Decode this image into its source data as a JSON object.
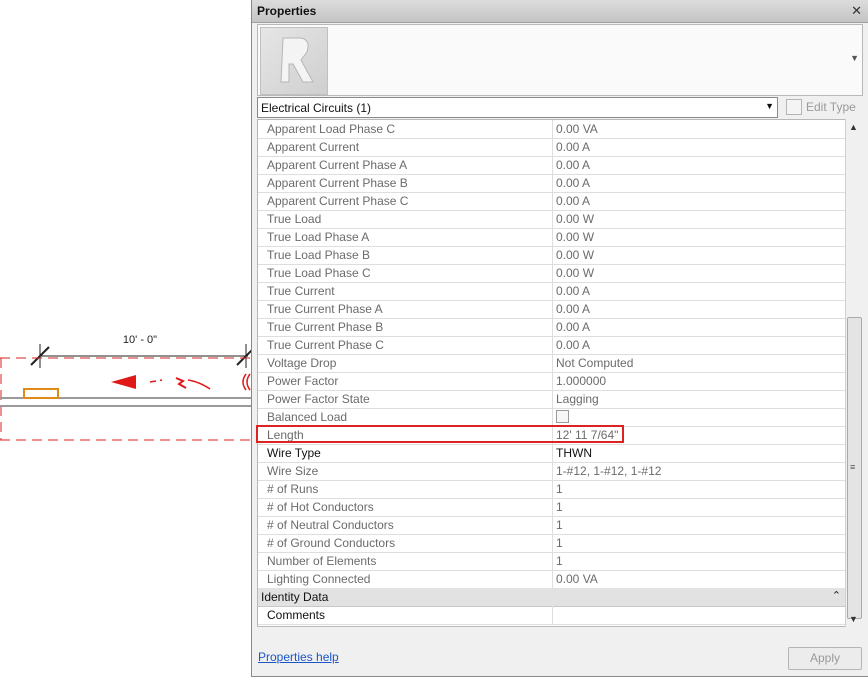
{
  "canvas": {
    "dimension_label": "10' - 0\""
  },
  "panel": {
    "title": "Properties",
    "close_icon": "close-icon",
    "type_selector": "Electrical Circuits (1)",
    "edit_type_label": "Edit Type",
    "properties": [
      {
        "name": "Apparent Load Phase C",
        "value": "0.00 VA",
        "editable": false
      },
      {
        "name": "Apparent Current",
        "value": "0.00 A",
        "editable": false
      },
      {
        "name": "Apparent Current Phase A",
        "value": "0.00 A",
        "editable": false
      },
      {
        "name": "Apparent Current Phase B",
        "value": "0.00 A",
        "editable": false
      },
      {
        "name": "Apparent Current Phase C",
        "value": "0.00 A",
        "editable": false
      },
      {
        "name": "True Load",
        "value": "0.00 W",
        "editable": false
      },
      {
        "name": "True Load Phase A",
        "value": "0.00 W",
        "editable": false
      },
      {
        "name": "True Load Phase B",
        "value": "0.00 W",
        "editable": false
      },
      {
        "name": "True Load Phase C",
        "value": "0.00 W",
        "editable": false
      },
      {
        "name": "True Current",
        "value": "0.00 A",
        "editable": false
      },
      {
        "name": "True Current Phase A",
        "value": "0.00 A",
        "editable": false
      },
      {
        "name": "True Current Phase B",
        "value": "0.00 A",
        "editable": false
      },
      {
        "name": "True Current Phase C",
        "value": "0.00 A",
        "editable": false
      },
      {
        "name": "Voltage Drop",
        "value": "Not Computed",
        "editable": false
      },
      {
        "name": "Power Factor",
        "value": "1.000000",
        "editable": false
      },
      {
        "name": "Power Factor State",
        "value": "Lagging",
        "editable": false
      },
      {
        "name": "Balanced Load",
        "value": "",
        "editable": false,
        "checkbox": true
      },
      {
        "name": "Length",
        "value": "12'  11 7/64\"",
        "editable": false
      },
      {
        "name": "Wire Type",
        "value": "THWN",
        "editable": true
      },
      {
        "name": "Wire Size",
        "value": "1-#12, 1-#12, 1-#12",
        "editable": false
      },
      {
        "name": "# of Runs",
        "value": "1",
        "editable": false
      },
      {
        "name": "# of Hot Conductors",
        "value": "1",
        "editable": false
      },
      {
        "name": "# of Neutral Conductors",
        "value": "1",
        "editable": false
      },
      {
        "name": "# of Ground Conductors",
        "value": "1",
        "editable": false
      },
      {
        "name": "Number of Elements",
        "value": "1",
        "editable": false
      },
      {
        "name": "Lighting Connected",
        "value": "0.00 VA",
        "editable": false
      }
    ],
    "group": {
      "title": "Identity Data",
      "collapse_icon": "collapse-icon",
      "rows": [
        {
          "name": "Comments",
          "value": ""
        }
      ]
    },
    "help_link": "Properties help",
    "apply_label": "Apply"
  },
  "colors": {
    "highlight": "#dd2222",
    "link": "#1a56c8",
    "readonly_text": "#6b6b6b"
  }
}
